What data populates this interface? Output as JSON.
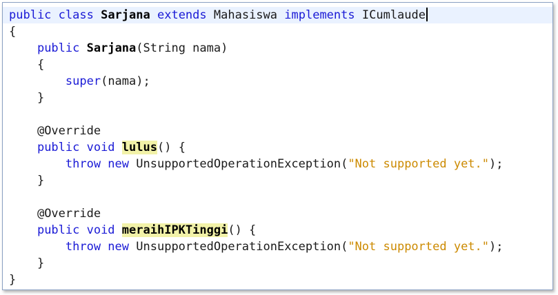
{
  "editor": {
    "lines": {
      "l1": {
        "kw1": "public class",
        "classname": "Sarjana",
        "kw2": "extends",
        "parent": "Mahasiswa",
        "kw3": "implements",
        "iface": "ICumlaude"
      },
      "l2": {
        "text": "{"
      },
      "l3": {
        "kw": "public",
        "name": "Sarjana",
        "params": "(String nama)"
      },
      "l4": {
        "text": "{"
      },
      "l5": {
        "kw": "super",
        "rest": "(nama);"
      },
      "l6": {
        "text": "}"
      },
      "l7": {
        "text": ""
      },
      "l8": {
        "text": "@Override"
      },
      "l9": {
        "kw": "public void",
        "name": "lulus",
        "rest": "() {"
      },
      "l10": {
        "kw": "throw new",
        "cls": "UnsupportedOperationException(",
        "str": "\"Not supported yet.\"",
        "rest": ");"
      },
      "l11": {
        "text": "}"
      },
      "l12": {
        "text": ""
      },
      "l13": {
        "text": "@Override"
      },
      "l14": {
        "kw": "public void",
        "name": "meraihIPKTinggi",
        "rest": "() {"
      },
      "l15": {
        "kw": "throw new",
        "cls": "UnsupportedOperationException(",
        "str": "\"Not supported yet.\"",
        "rest": ");"
      },
      "l16": {
        "text": "}"
      },
      "l17": {
        "text": "}"
      }
    }
  },
  "colors": {
    "keyword": "#1a1ad6",
    "string": "#cc8a00",
    "highlight": "#f2f2a8",
    "current_line": "#eaf2ff"
  }
}
